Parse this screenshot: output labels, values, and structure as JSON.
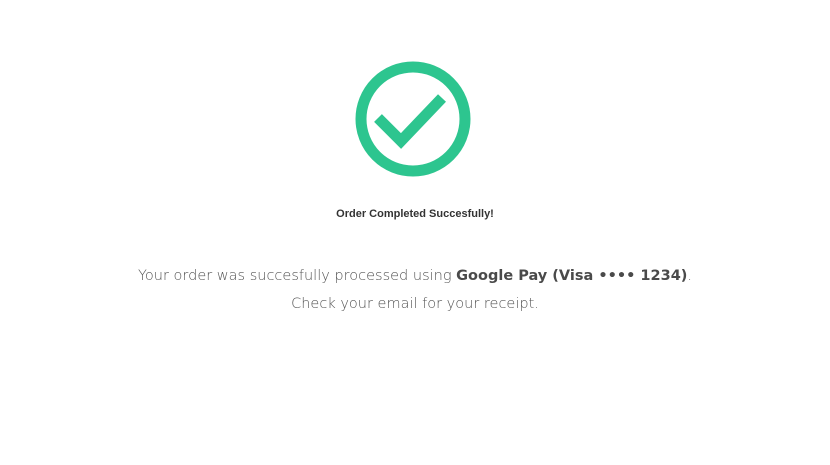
{
  "colors": {
    "success": "#2dc58f",
    "title_text": "#333333",
    "body_text": "#555555"
  },
  "icons": {
    "status": "check-circle-icon"
  },
  "confirmation": {
    "title": "Order Completed Succesfully!",
    "message_prefix": "Your order was succesfully processed using ",
    "payment_method": "Google Pay (Visa •••• 1234)",
    "message_suffix": ".",
    "message_line2": "Check your email for your receipt."
  }
}
